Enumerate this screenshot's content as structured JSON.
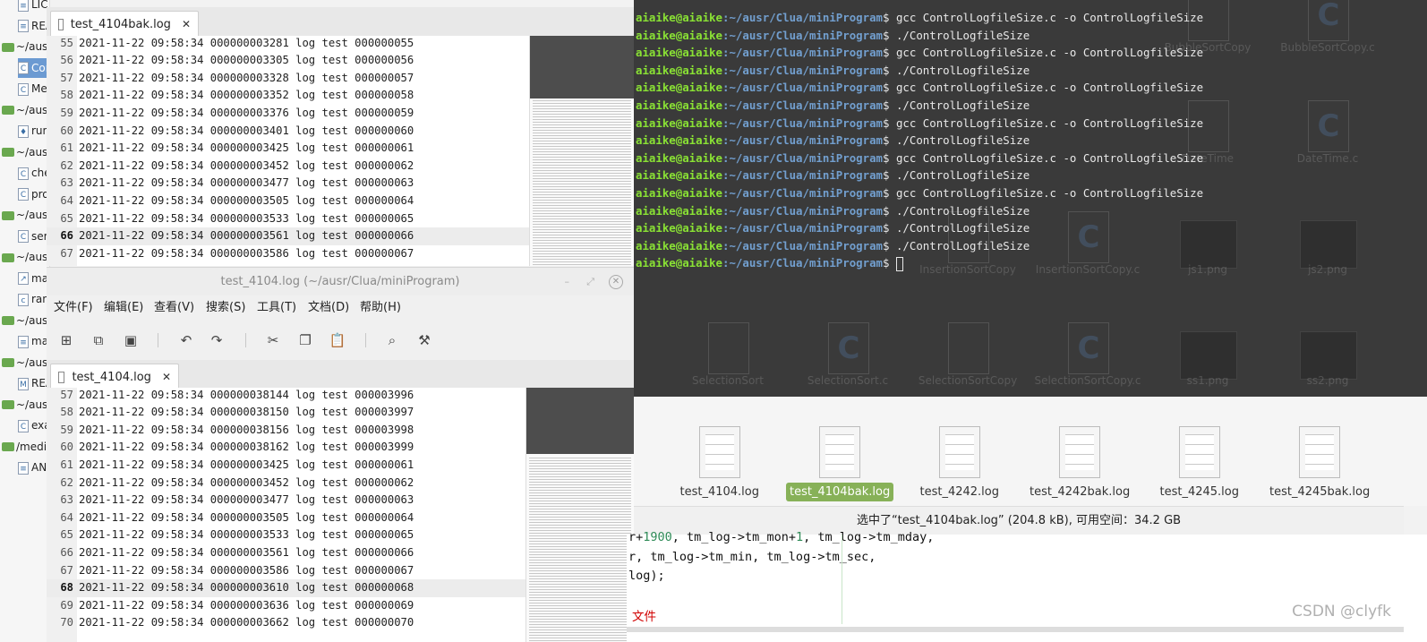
{
  "sidebar": {
    "items": [
      {
        "type": "file",
        "label": "LIC",
        "icon": "text-file-icon"
      },
      {
        "type": "file",
        "label": "REA",
        "icon": "text-file-icon"
      },
      {
        "type": "folder",
        "label": "~/ausr"
      },
      {
        "type": "file",
        "label": "Cor",
        "icon": "c-file-icon",
        "selected": true
      },
      {
        "type": "file",
        "label": "Me",
        "icon": "c-file-icon"
      },
      {
        "type": "folder",
        "label": "~/ausr"
      },
      {
        "type": "file",
        "label": "run",
        "icon": "python-file-icon"
      },
      {
        "type": "folder",
        "label": "~/ausr"
      },
      {
        "type": "file",
        "label": "che",
        "icon": "c-file-icon"
      },
      {
        "type": "file",
        "label": "pro",
        "icon": "c-file-icon"
      },
      {
        "type": "folder",
        "label": "~/ausr"
      },
      {
        "type": "file",
        "label": "ser",
        "icon": "c-file-icon"
      },
      {
        "type": "folder",
        "label": "~/ausr"
      },
      {
        "type": "file",
        "label": "ma",
        "icon": "makefile-icon"
      },
      {
        "type": "file",
        "label": "ran",
        "icon": "source-file-icon"
      },
      {
        "type": "folder",
        "label": "~/ausr"
      },
      {
        "type": "file",
        "label": "ma",
        "icon": "text-file-icon"
      },
      {
        "type": "folder",
        "label": "~/ausr"
      },
      {
        "type": "file",
        "label": "REA",
        "icon": "markdown-file-icon"
      },
      {
        "type": "folder",
        "label": "~/ausr"
      },
      {
        "type": "file",
        "label": "exa",
        "icon": "c-file-icon"
      },
      {
        "type": "folder",
        "label": "/media"
      },
      {
        "type": "file",
        "label": "AN",
        "icon": "text-file-icon"
      }
    ]
  },
  "editor1": {
    "tab_label": "test_4104bak.log",
    "current_line": 66,
    "lines": [
      {
        "n": "55",
        "t": "2021-11-22 09:58:34 000000003281 log test 000000055"
      },
      {
        "n": "56",
        "t": "2021-11-22 09:58:34 000000003305 log test 000000056"
      },
      {
        "n": "57",
        "t": "2021-11-22 09:58:34 000000003328 log test 000000057"
      },
      {
        "n": "58",
        "t": "2021-11-22 09:58:34 000000003352 log test 000000058"
      },
      {
        "n": "59",
        "t": "2021-11-22 09:58:34 000000003376 log test 000000059"
      },
      {
        "n": "60",
        "t": "2021-11-22 09:58:34 000000003401 log test 000000060"
      },
      {
        "n": "61",
        "t": "2021-11-22 09:58:34 000000003425 log test 000000061"
      },
      {
        "n": "62",
        "t": "2021-11-22 09:58:34 000000003452 log test 000000062"
      },
      {
        "n": "63",
        "t": "2021-11-22 09:58:34 000000003477 log test 000000063"
      },
      {
        "n": "64",
        "t": "2021-11-22 09:58:34 000000003505 log test 000000064"
      },
      {
        "n": "65",
        "t": "2021-11-22 09:58:34 000000003533 log test 000000065"
      },
      {
        "n": "66",
        "t": "2021-11-22 09:58:34 000000003561 log test 000000066"
      },
      {
        "n": "67",
        "t": "2021-11-22 09:58:34 000000003586 log test 000000067"
      }
    ]
  },
  "editor2": {
    "window_title": "test_4104.log (~/ausr/Clua/miniProgram)",
    "tab_label": "test_4104.log",
    "current_line": 68,
    "menu": [
      "文件(F)",
      "编辑(E)",
      "查看(V)",
      "搜索(S)",
      "工具(T)",
      "文档(D)",
      "帮助(H)"
    ],
    "lines": [
      {
        "n": "57",
        "t": "2021-11-22 09:58:34 000000038144 log test 000003996"
      },
      {
        "n": "58",
        "t": "2021-11-22 09:58:34 000000038150 log test 000003997"
      },
      {
        "n": "59",
        "t": "2021-11-22 09:58:34 000000038156 log test 000003998"
      },
      {
        "n": "60",
        "t": "2021-11-22 09:58:34 000000038162 log test 000003999"
      },
      {
        "n": "61",
        "t": "2021-11-22 09:58:34 000000003425 log test 000000061"
      },
      {
        "n": "62",
        "t": "2021-11-22 09:58:34 000000003452 log test 000000062"
      },
      {
        "n": "63",
        "t": "2021-11-22 09:58:34 000000003477 log test 000000063"
      },
      {
        "n": "64",
        "t": "2021-11-22 09:58:34 000000003505 log test 000000064"
      },
      {
        "n": "65",
        "t": "2021-11-22 09:58:34 000000003533 log test 000000065"
      },
      {
        "n": "66",
        "t": "2021-11-22 09:58:34 000000003561 log test 000000066"
      },
      {
        "n": "67",
        "t": "2021-11-22 09:58:34 000000003586 log test 000000067"
      },
      {
        "n": "68",
        "t": "2021-11-22 09:58:34 000000003610 log test 000000068"
      },
      {
        "n": "69",
        "t": "2021-11-22 09:58:34 000000003636 log test 000000069"
      },
      {
        "n": "70",
        "t": "2021-11-22 09:58:34 000000003662 log test 000000070"
      }
    ]
  },
  "terminal": {
    "user": "aiaike@aiaike",
    "path": ":~/ausr/Clua/miniProgram",
    "prompt_suffix": "$ ",
    "commands": [
      "gcc ControlLogfileSize.c -o ControlLogfileSize",
      "./ControlLogfileSize",
      "gcc ControlLogfileSize.c -o ControlLogfileSize",
      "./ControlLogfileSize",
      "gcc ControlLogfileSize.c -o ControlLogfileSize",
      "./ControlLogfileSize",
      "gcc ControlLogfileSize.c -o ControlLogfileSize",
      "./ControlLogfileSize",
      "gcc ControlLogfileSize.c -o ControlLogfileSize",
      "./ControlLogfileSize",
      "gcc ControlLogfileSize.c -o ControlLogfileSize",
      "./ControlLogfileSize",
      "./ControlLogfileSize",
      "./ControlLogfileSize",
      ""
    ]
  },
  "file_manager_behind": {
    "labels": [
      "BubbleSortCopy",
      "BubbleSortCopy.c",
      "DateTime",
      "DateTime.c",
      "InsertionSortCopy",
      "InsertionSortCopy.c",
      "js1.png",
      "js2.png",
      "SelectionSort",
      "SelectionSort.c",
      "SelectionSortCopy",
      "SelectionSortCopy.c",
      "ss1.png",
      "ss2.png"
    ]
  },
  "file_manager": {
    "files": [
      {
        "name": "test_4104.log",
        "selected": false
      },
      {
        "name": "test_4104bak.log",
        "selected": true
      },
      {
        "name": "test_4242.log",
        "selected": false
      },
      {
        "name": "test_4242bak.log",
        "selected": false
      },
      {
        "name": "test_4245.log",
        "selected": false
      },
      {
        "name": "test_4245bak.log",
        "selected": false
      }
    ],
    "status": "选中了“test_4104bak.log” (204.8 kB), 可用空间：34.2 GB"
  },
  "code_behind": {
    "line1_a": "r+",
    "line1_num1": "1900",
    "line1_b": ", tm_log->tm_mon+",
    "line1_num2": "1",
    "line1_c": ", tm_log->tm_mday,",
    "line2": "r, tm_log->tm_min, tm_log->tm_sec,",
    "line3": "log);",
    "comment": "文件"
  },
  "watermark": "CSDN @clyfk"
}
